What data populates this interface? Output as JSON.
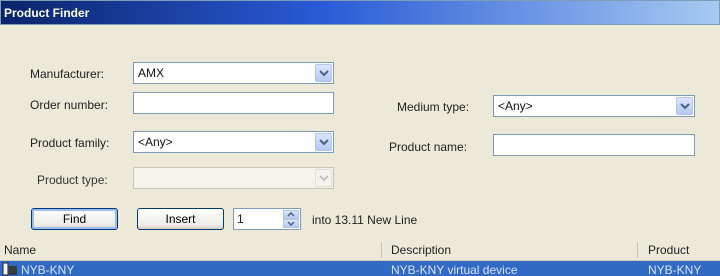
{
  "window": {
    "title": "Product Finder"
  },
  "form": {
    "manufacturer": {
      "label": "Manufacturer:",
      "value": "AMX"
    },
    "order_number": {
      "label": "Order number:",
      "value": ""
    },
    "product_family": {
      "label": "Product family:",
      "value": "<Any>"
    },
    "product_type": {
      "label": "Product type:",
      "value": ""
    },
    "medium_type": {
      "label": "Medium type:",
      "value": "<Any>"
    },
    "product_name": {
      "label": "Product name:",
      "value": ""
    }
  },
  "actions": {
    "find_label": "Find",
    "insert_label": "Insert",
    "quantity": "1",
    "into_text": "into  13.11 New Line"
  },
  "list": {
    "columns": [
      "Name",
      "Description",
      "Product"
    ],
    "rows": [
      {
        "name": "NYB-KNY",
        "description": "NYB-KNY virtual device",
        "product": "NYB-KNY",
        "selected": true
      }
    ]
  },
  "colors": {
    "selection": "#316ac5",
    "title_bar": "#0a246a"
  }
}
